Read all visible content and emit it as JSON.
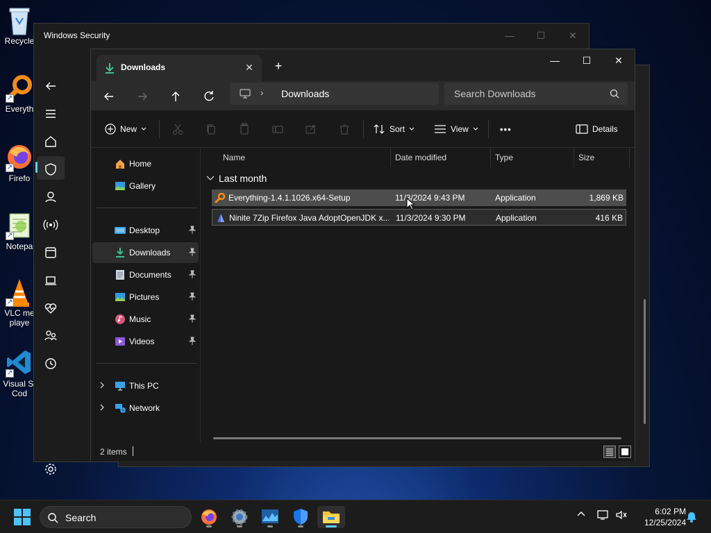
{
  "desktop": {
    "icons": [
      {
        "label": "Recycle"
      },
      {
        "label": "Everyth"
      },
      {
        "label": "Firefo"
      },
      {
        "label": "Notepa"
      },
      {
        "label": "VLC me\nplaye"
      },
      {
        "label": "Visual St\nCod"
      }
    ]
  },
  "windows_security": {
    "title": "Windows Security",
    "controls": {
      "minimize": "—",
      "maximize": "☐",
      "close": "✕"
    }
  },
  "explorer": {
    "tab": {
      "label": "Downloads",
      "close": "✕",
      "new": "+"
    },
    "controls": {
      "minimize": "—",
      "maximize": "☐",
      "close": "✕"
    },
    "address": {
      "location": "Downloads",
      "separator": "›"
    },
    "search": {
      "placeholder": "Search Downloads"
    },
    "toolbar": {
      "new": "New",
      "sort": "Sort",
      "view": "View",
      "more": "•••",
      "details": "Details"
    },
    "nav": {
      "quick": [
        {
          "label": "Home",
          "icon": "home-icon"
        },
        {
          "label": "Gallery",
          "icon": "gallery-icon"
        }
      ],
      "pinned": [
        {
          "label": "Desktop",
          "icon": "desktop-folder-icon"
        },
        {
          "label": "Downloads",
          "icon": "downloads-folder-icon"
        },
        {
          "label": "Documents",
          "icon": "documents-folder-icon"
        },
        {
          "label": "Pictures",
          "icon": "pictures-folder-icon"
        },
        {
          "label": "Music",
          "icon": "music-folder-icon"
        },
        {
          "label": "Videos",
          "icon": "videos-folder-icon"
        }
      ],
      "tree": [
        {
          "label": "This PC",
          "icon": "this-pc-icon"
        },
        {
          "label": "Network",
          "icon": "network-icon"
        }
      ]
    },
    "columns": {
      "name": "Name",
      "date": "Date modified",
      "type": "Type",
      "size": "Size"
    },
    "group": {
      "label": "Last month"
    },
    "files": [
      {
        "name": "Everything-1.4.1.1026.x64-Setup",
        "date": "11/3/2024 9:43 PM",
        "type": "Application",
        "size": "1,869 KB"
      },
      {
        "name": "Ninite 7Zip Firefox Java AdoptOpenJDK x...",
        "date": "11/3/2024 9:30 PM",
        "type": "Application",
        "size": "416 KB"
      }
    ],
    "status": {
      "count": "2 items"
    }
  },
  "taskbar": {
    "search_label": "Search",
    "clock": {
      "time": "6:02 PM",
      "date": "12/25/2024"
    }
  },
  "colors": {
    "accent": "#60cdff",
    "window_bg": "#191919",
    "hover_row": "#4d4d4d"
  }
}
